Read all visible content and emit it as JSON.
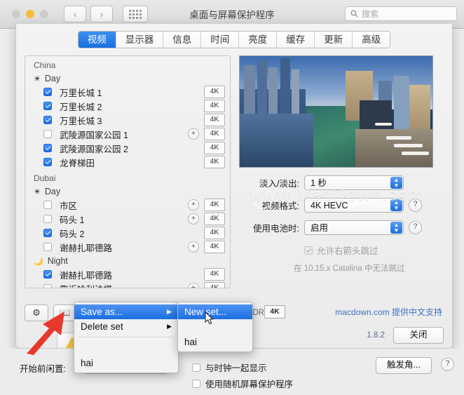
{
  "window": {
    "title": "桌面与屏幕保护程序",
    "search_placeholder": "搜索",
    "search_value": "",
    "nav_back": "‹",
    "nav_forward": "›",
    "grid_icon": "grid-icon"
  },
  "tabs": [
    {
      "label": "视频",
      "active": true
    },
    {
      "label": "显示器",
      "active": false
    },
    {
      "label": "信息",
      "active": false
    },
    {
      "label": "时间",
      "active": false
    },
    {
      "label": "亮度",
      "active": false
    },
    {
      "label": "缓存",
      "active": false
    },
    {
      "label": "更新",
      "active": false
    },
    {
      "label": "高级",
      "active": false
    }
  ],
  "list": {
    "groups": [
      {
        "name": "China",
        "sections": [
          {
            "name": "Day",
            "icon": "sun-icon",
            "rows": [
              {
                "label": "万里长城 1",
                "checked": true,
                "plus": false,
                "quality": "4K"
              },
              {
                "label": "万里长城 2",
                "checked": true,
                "plus": false,
                "quality": "4K"
              },
              {
                "label": "万里长城 3",
                "checked": true,
                "plus": false,
                "quality": "4K"
              },
              {
                "label": "武陵源国家公园 1",
                "checked": false,
                "plus": true,
                "quality": "4K"
              },
              {
                "label": "武陵源国家公园 2",
                "checked": true,
                "plus": false,
                "quality": "4K"
              },
              {
                "label": "龙脊梯田",
                "checked": true,
                "plus": false,
                "quality": "4K"
              }
            ]
          }
        ]
      },
      {
        "name": "Dubai",
        "sections": [
          {
            "name": "Day",
            "icon": "sun-icon",
            "rows": [
              {
                "label": "市区",
                "checked": false,
                "plus": true,
                "quality": "4K"
              },
              {
                "label": "码头 1",
                "checked": false,
                "plus": true,
                "quality": "4K"
              },
              {
                "label": "码头 2",
                "checked": true,
                "plus": false,
                "quality": "4K"
              },
              {
                "label": "谢赫扎耶德路",
                "checked": false,
                "plus": true,
                "quality": "4K"
              }
            ]
          },
          {
            "name": "Night",
            "icon": "moon-icon",
            "rows": [
              {
                "label": "谢赫扎耶德路",
                "checked": true,
                "plus": false,
                "quality": "4K"
              },
              {
                "label": "靠近哈利法塔",
                "checked": false,
                "plus": true,
                "quality": "4K"
              }
            ]
          }
        ]
      }
    ]
  },
  "settings": {
    "fade_label": "淡入/淡出:",
    "fade_value": "1 秒",
    "format_label": "视频格式:",
    "format_value": "4K HEVC",
    "battery_label": "使用电池时:",
    "battery_value": "启用",
    "skip_label": "允许右箭头跳过",
    "skip_checked": true,
    "note": "在 10.15.x Catalina 中无法跳过",
    "help_label": "?"
  },
  "sheet_footer": {
    "gear_icon": "gear-icon",
    "book_icon": "book-icon",
    "provides_text": "提供4K/HDR",
    "provides_badge": "4K",
    "credit": "macdown.com 提供中文支持",
    "version": "1.8.2",
    "close_label": "关闭"
  },
  "context_menu": {
    "items": [
      {
        "label": "Save as...",
        "submenu": true,
        "selected": true
      },
      {
        "label": "Delete set",
        "submenu": true,
        "selected": false
      }
    ],
    "set_name": "hai"
  },
  "submenu": {
    "items": [
      {
        "label": "New set...",
        "selected": true
      }
    ],
    "set_name": "hai"
  },
  "prefs_bottom": {
    "idle_label": "开始前闲置:",
    "idle_value": "hai",
    "clock_label": "与时钟一起显示",
    "clock_checked": false,
    "random_label": "使用随机屏幕保护程序",
    "random_checked": false,
    "hotcorners_label": "触发角...",
    "help_label": "?"
  },
  "watermark": {
    "text": "www.MacDown.com"
  },
  "colors": {
    "accent_blue": "#1a6ee0",
    "tab_selected": "#2f82ee",
    "link_blue": "#3f72c4",
    "warning_yellow": "#f5c543",
    "annotation_red": "#e8382b",
    "window_bg": "#ececec"
  }
}
